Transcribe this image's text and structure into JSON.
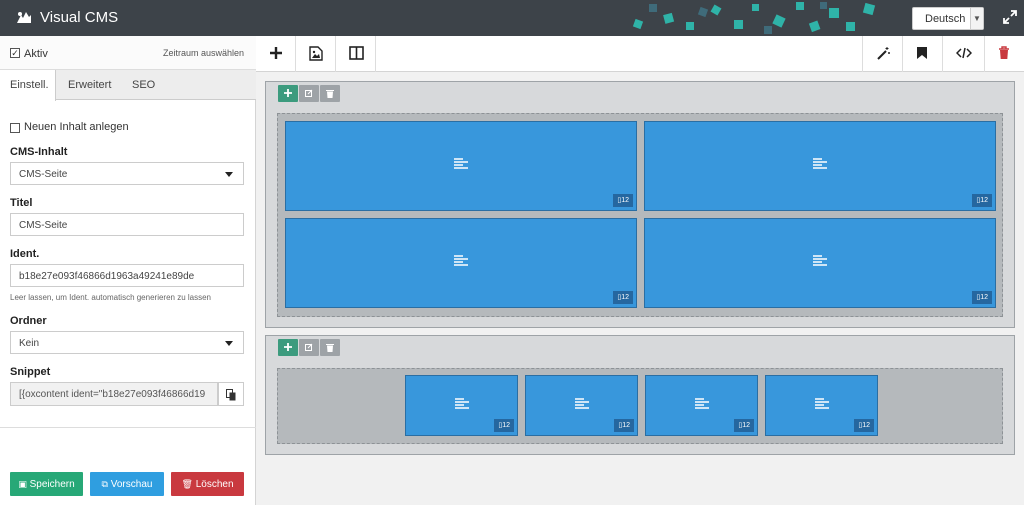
{
  "app": {
    "title": "Visual CMS"
  },
  "header": {
    "language": "Deutsch"
  },
  "sidebar": {
    "aktiv_label": "Aktiv",
    "zeitraum_link": "Zeitraum auswählen",
    "tabs": [
      {
        "label": "Einstell."
      },
      {
        "label": "Erweitert"
      },
      {
        "label": "SEO"
      }
    ],
    "new_content_label": "Neuen Inhalt anlegen",
    "cms_content_label": "CMS-Inhalt",
    "cms_content_value": "CMS-Seite",
    "title_label": "Titel",
    "title_value": "CMS-Seite",
    "ident_label": "Ident.",
    "ident_value": "b18e27e093f46866d1963a49241e89de",
    "ident_hint": "Leer lassen, um Ident. automatisch generieren zu lassen",
    "folder_label": "Ordner",
    "folder_value": "Kein",
    "snippet_label": "Snippet",
    "snippet_value": "[{oxcontent ident=\"b18e27e093f46866d19"
  },
  "actions": {
    "save": "Speichern",
    "preview": "Vorschau",
    "delete": "Löschen"
  },
  "canvas": {
    "block_badge": "12",
    "section1_blocks": 4,
    "section2_blocks": 4
  },
  "colors": {
    "topbar": "#3d4349",
    "block": "#3897dc",
    "save": "#27a877",
    "preview": "#2f9ee0",
    "delete": "#c9393f",
    "add": "#3c9b7e"
  }
}
